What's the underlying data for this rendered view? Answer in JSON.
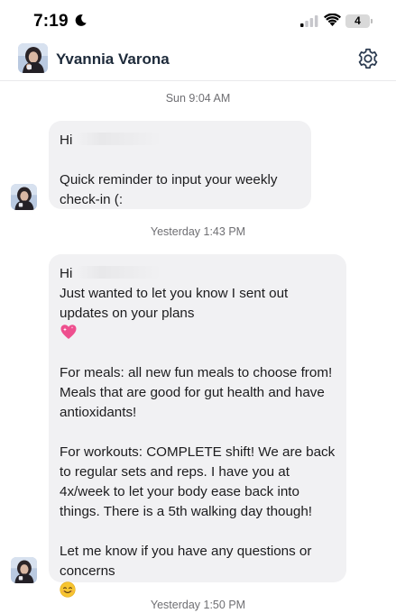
{
  "status_bar": {
    "time": "7:19",
    "battery_level": "4",
    "icons": [
      "moon-icon",
      "cellular-signal-icon",
      "wifi-icon",
      "battery-icon"
    ]
  },
  "header": {
    "contact_name": "Yvannia Varona",
    "avatar": "contact-avatar",
    "settings_icon": "gear-icon"
  },
  "messages": [
    {
      "timestamp": "Sun 9:04 AM",
      "greeting": "Hi",
      "paragraphs": [
        "Quick reminder to input your weekly check-in (:"
      ]
    },
    {
      "timestamp": "Yesterday 1:43 PM",
      "greeting": "Hi",
      "paragraphs": [
        "Just wanted to let you know I sent out updates on your plans",
        "For meals: all new fun meals to choose from! Meals that are good for gut health and have antioxidants!",
        "For workouts: COMPLETE shift! We are back to regular sets and reps. I have you at 4x/week to let your body ease back into things. There is a 5th walking day though!",
        "Let me know if you have any questions or concerns"
      ],
      "emojis": [
        "sparkling-heart-emoji",
        "smiling-face-emoji"
      ]
    },
    {
      "timestamp": "Yesterday 1:50 PM"
    }
  ],
  "colors": {
    "bubble": "#f1f1f3",
    "timestamp_text": "#6f6f73",
    "header_name": "#1d2a3a",
    "heart_emoji": "#ee4f8e",
    "smile_emoji": "#f7c531"
  }
}
